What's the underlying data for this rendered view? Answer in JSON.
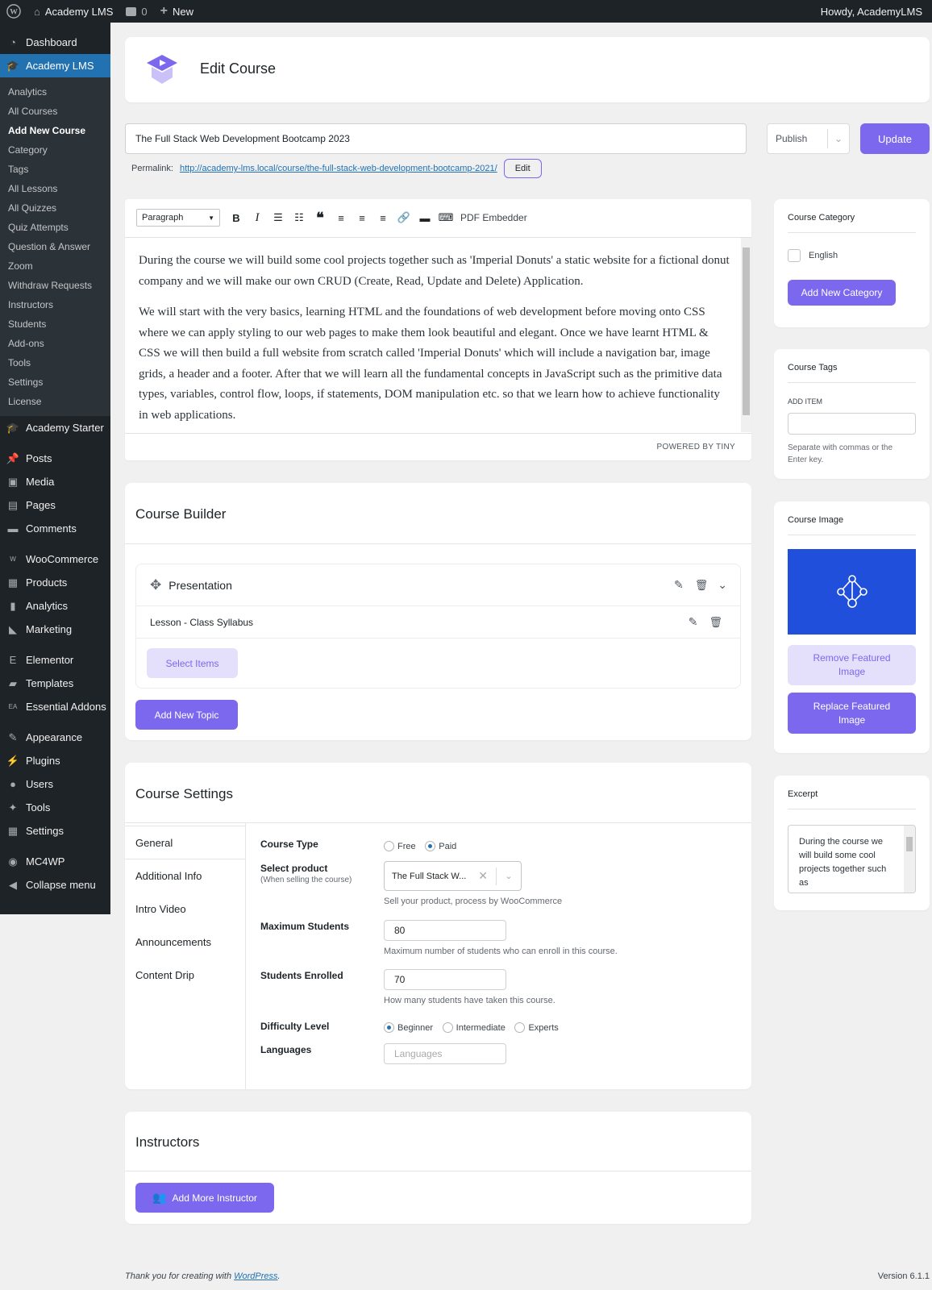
{
  "admin_bar": {
    "site_name": "Academy LMS",
    "comments_count": "0",
    "new_label": "New",
    "howdy": "Howdy, AcademyLMS"
  },
  "sidebar": {
    "top_before": [
      {
        "label": "Dashboard",
        "icon": "dashboard-icon"
      }
    ],
    "current": {
      "label": "Academy LMS",
      "icon": "academy-cap-icon"
    },
    "sub_items": [
      "Analytics",
      "All Courses",
      "Add New Course",
      "Category",
      "Tags",
      "All Lessons",
      "All Quizzes",
      "Quiz Attempts",
      "Question & Answer",
      "Zoom",
      "Withdraw Requests",
      "Instructors",
      "Students",
      "Add-ons",
      "Tools",
      "Settings",
      "License"
    ],
    "active_sub": "Add New Course",
    "groups": [
      [
        {
          "label": "Academy Starter",
          "icon": "cap-icon"
        }
      ],
      [
        {
          "label": "Posts",
          "icon": "pin-icon"
        },
        {
          "label": "Media",
          "icon": "media-icon"
        },
        {
          "label": "Pages",
          "icon": "pages-icon"
        },
        {
          "label": "Comments",
          "icon": "comment-icon"
        }
      ],
      [
        {
          "label": "WooCommerce",
          "icon": "woo-icon"
        },
        {
          "label": "Products",
          "icon": "archive-icon"
        },
        {
          "label": "Analytics",
          "icon": "bar-chart-icon"
        },
        {
          "label": "Marketing",
          "icon": "megaphone-icon"
        }
      ],
      [
        {
          "label": "Elementor",
          "icon": "elementor-icon"
        },
        {
          "label": "Templates",
          "icon": "folder-icon"
        },
        {
          "label": "Essential Addons",
          "icon": "ea-icon"
        }
      ],
      [
        {
          "label": "Appearance",
          "icon": "brush-icon"
        },
        {
          "label": "Plugins",
          "icon": "plug-icon"
        },
        {
          "label": "Users",
          "icon": "user-icon"
        },
        {
          "label": "Tools",
          "icon": "wrench-icon"
        },
        {
          "label": "Settings",
          "icon": "settings-icon"
        }
      ],
      [
        {
          "label": "MC4WP",
          "icon": "mc4wp-icon"
        },
        {
          "label": "Collapse menu",
          "icon": "collapse-icon"
        }
      ]
    ]
  },
  "header": {
    "title": "Edit Course"
  },
  "course": {
    "title": "The Full Stack Web Development Bootcamp 2023",
    "permalink_label": "Permalink:",
    "permalink_url": "http://academy-lms.local/course/the-full-stack-web-development-bootcamp-2021/",
    "edit_label": "Edit",
    "publish_label": "Publish",
    "update_label": "Update"
  },
  "editor": {
    "format": "Paragraph",
    "pdf_label": "PDF Embedder",
    "paragraph1": "During the course we will build some cool projects together such as 'Imperial Donuts' a static website for a fictional donut company and we will make our own CRUD (Create, Read, Update and Delete) Application.",
    "paragraph2": "We will start with the very basics, learning HTML and the foundations of web development before moving onto CSS where we can apply styling to our web pages to make them look beautiful and elegant. Once we have learnt HTML & CSS we will then build a full website from scratch called 'Imperial Donuts' which will include a navigation bar, image grids, a header and a footer. After that we will learn all the fundamental concepts in JavaScript such as the primitive data types, variables, control flow, loops, if statements, DOM manipulation etc. so that we learn how to achieve functionality in web applications.",
    "powered": "POWERED BY TINY"
  },
  "builder": {
    "title": "Course Builder",
    "topic": "Presentation",
    "lesson": "Lesson - Class Syllabus",
    "select_items": "Select Items",
    "add_topic": "Add New Topic"
  },
  "settings": {
    "title": "Course Settings",
    "tabs": [
      "General",
      "Additional Info",
      "Intro Video",
      "Announcements",
      "Content Drip"
    ],
    "course_type_label": "Course Type",
    "free_label": "Free",
    "paid_label": "Paid",
    "select_product_label": "Select product",
    "select_product_sub": "(When selling the course)",
    "product_value": "The Full Stack W...",
    "product_help": "Sell your product, process by WooCommerce",
    "max_students_label": "Maximum Students",
    "max_students_value": "80",
    "max_students_help": "Maximum number of students who can enroll in this course.",
    "enrolled_label": "Students Enrolled",
    "enrolled_value": "70",
    "enrolled_help": "How many students have taken this course.",
    "difficulty_label": "Difficulty Level",
    "difficulty_options": [
      "Beginner",
      "Intermediate",
      "Experts"
    ],
    "languages_label": "Languages",
    "languages_placeholder": "Languages"
  },
  "instructors": {
    "title": "Instructors",
    "add_label": "Add More Instructor"
  },
  "side": {
    "category_title": "Course Category",
    "category_option": "English",
    "add_category": "Add New Category",
    "tags_title": "Course Tags",
    "add_item": "ADD ITEM",
    "tags_help": "Separate with commas or the Enter key.",
    "image_title": "Course Image",
    "remove_image": "Remove Featured Image",
    "replace_image": "Replace Featured Image",
    "excerpt_title": "Excerpt",
    "excerpt_text": "During the course we will build some cool projects together such as"
  },
  "footer": {
    "thanks": "Thank you for creating with ",
    "wp_link": "WordPress",
    "period": ".",
    "version": "Version 6.1.1"
  },
  "colors": {
    "accent": "#7b68ee",
    "wp_blue": "#2271b1",
    "image_bg": "#1f4fdb"
  }
}
